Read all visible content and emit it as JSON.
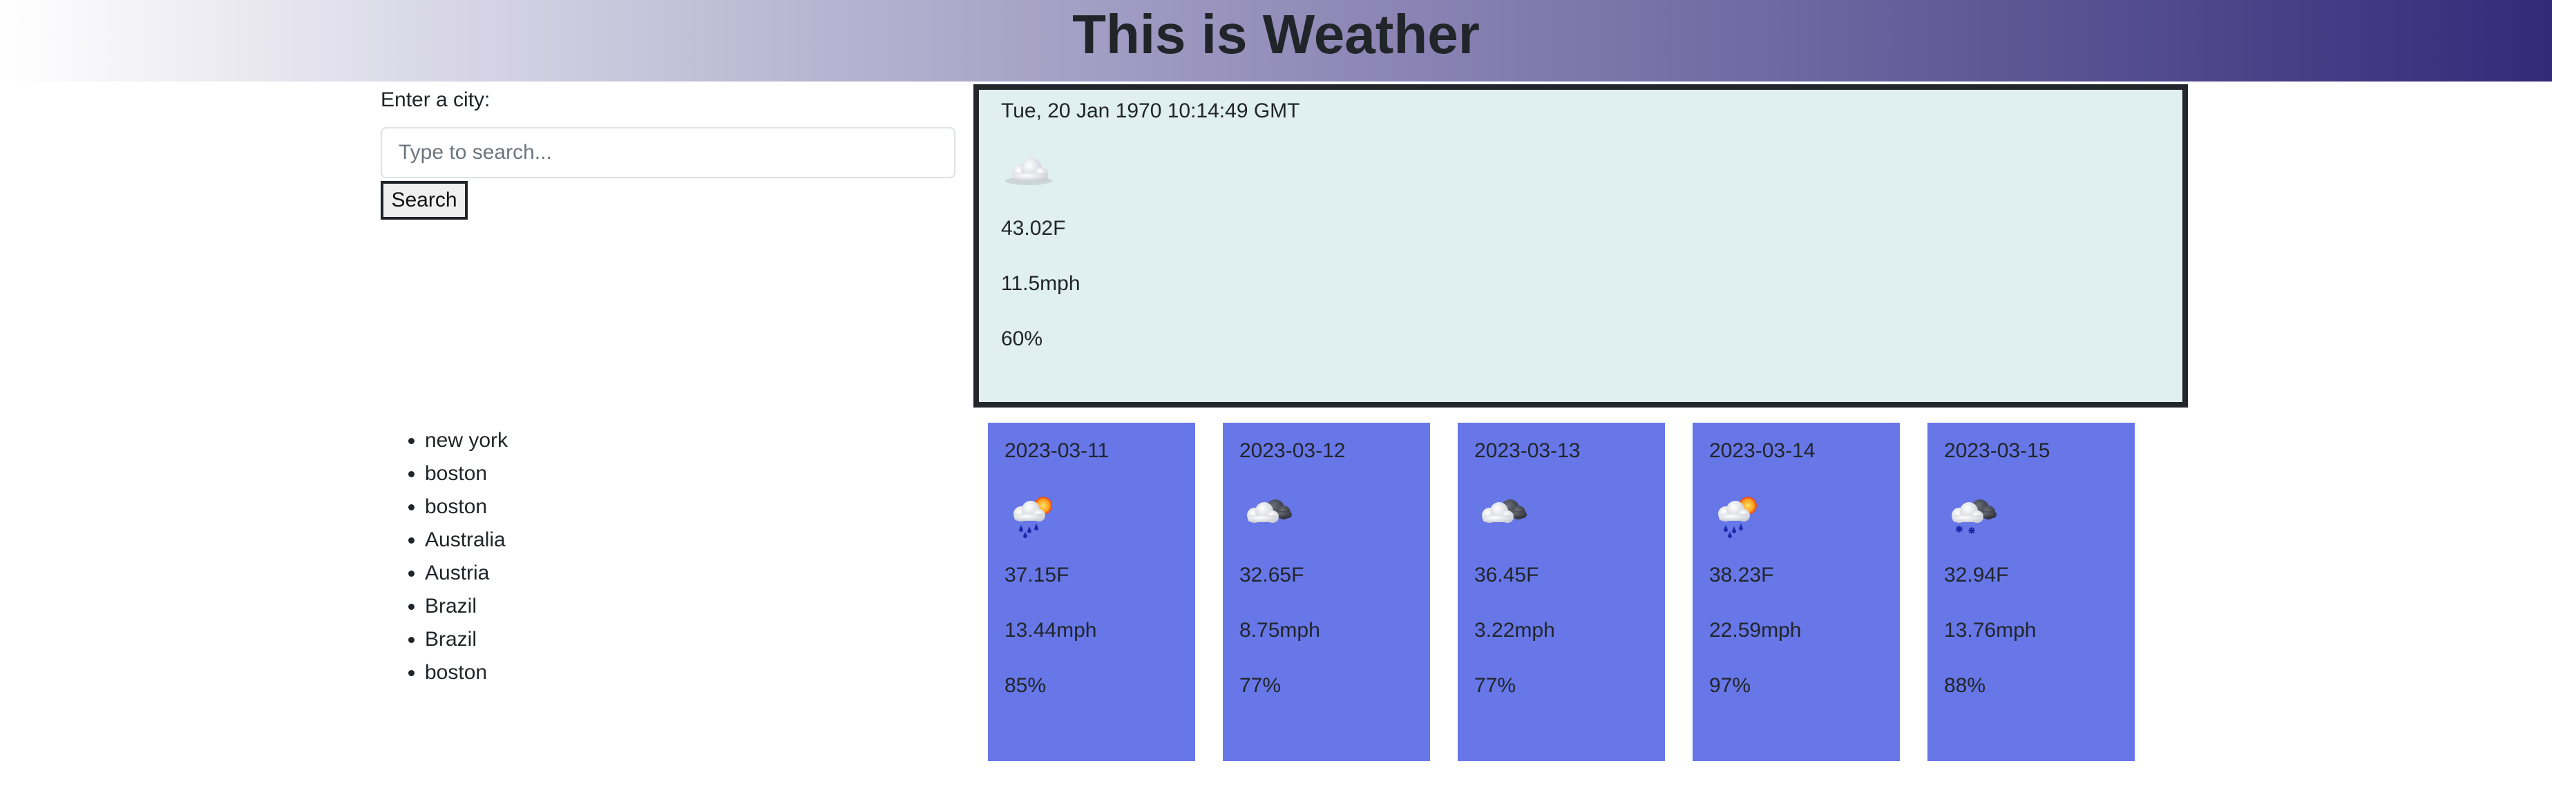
{
  "header": {
    "title": "This is Weather"
  },
  "search": {
    "label": "Enter a city:",
    "placeholder": "Type to search...",
    "value": "",
    "button_label": "Search"
  },
  "history": [
    "new york",
    "boston",
    "boston",
    "Australia",
    "Austria",
    "Brazil",
    "Brazil",
    "boston"
  ],
  "current": {
    "datetime": "Tue, 20 Jan 1970 10:14:49 GMT",
    "icon": "cloud-icon",
    "temp": "43.02F",
    "wind": "11.5mph",
    "humidity": "60%"
  },
  "forecast": [
    {
      "date": "2023-03-11",
      "icon": "rain-sun-icon",
      "temp": "37.15F",
      "wind": "13.44mph",
      "humidity": "85%"
    },
    {
      "date": "2023-03-12",
      "icon": "cloudy-icon",
      "temp": "32.65F",
      "wind": "8.75mph",
      "humidity": "77%"
    },
    {
      "date": "2023-03-13",
      "icon": "cloudy-icon",
      "temp": "36.45F",
      "wind": "3.22mph",
      "humidity": "77%"
    },
    {
      "date": "2023-03-14",
      "icon": "rain-sun-icon",
      "temp": "38.23F",
      "wind": "22.59mph",
      "humidity": "97%"
    },
    {
      "date": "2023-03-15",
      "icon": "snow-cloud-icon",
      "temp": "32.94F",
      "wind": "13.76mph",
      "humidity": "88%"
    }
  ],
  "colors": {
    "card_background": "#6777e8",
    "current_background": "#e0efef",
    "header_gradient_end": "#322a78"
  }
}
